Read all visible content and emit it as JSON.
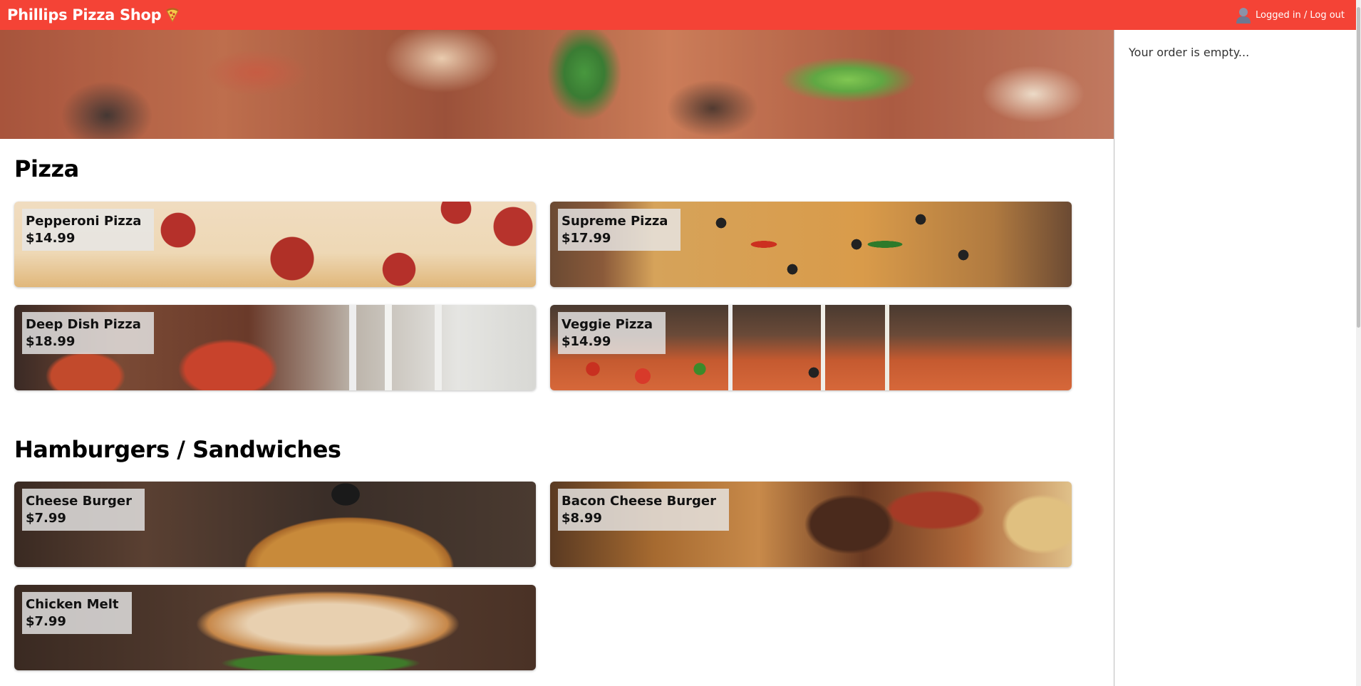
{
  "header": {
    "brand": "Phillips Pizza Shop",
    "login_text": "Logged in / Log out"
  },
  "sections": [
    {
      "title": "Pizza",
      "items": [
        {
          "name": "Pepperoni Pizza",
          "price": "$14.99"
        },
        {
          "name": "Supreme Pizza",
          "price": "$17.99"
        },
        {
          "name": "Deep Dish Pizza",
          "price": "$18.99"
        },
        {
          "name": "Veggie Pizza",
          "price": "$14.99"
        }
      ]
    },
    {
      "title": "Hamburgers / Sandwiches",
      "items": [
        {
          "name": "Cheese Burger",
          "price": "$7.99"
        },
        {
          "name": "Bacon Cheese Burger",
          "price": "$8.99"
        },
        {
          "name": "Chicken Melt",
          "price": "$7.99"
        }
      ]
    }
  ],
  "order": {
    "empty_text": "Your order is empty..."
  },
  "icons": {
    "brand": "pizza-slice-icon",
    "login": "user-icon"
  },
  "colors": {
    "header_bg": "#f44336",
    "header_text": "#ffffff"
  }
}
